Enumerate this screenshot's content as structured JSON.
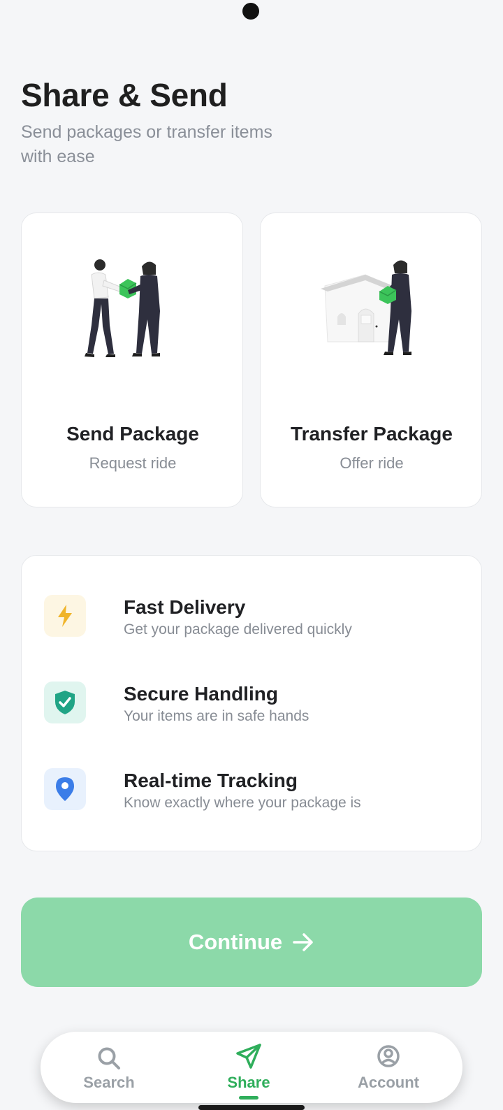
{
  "header": {
    "title": "Share & Send",
    "subtitle": "Send packages or transfer items with ease"
  },
  "cards": [
    {
      "title": "Send Package",
      "subtitle": "Request ride",
      "icon": "handover-illustration"
    },
    {
      "title": "Transfer Package",
      "subtitle": "Offer ride",
      "icon": "house-delivery-illustration"
    }
  ],
  "features": [
    {
      "title": "Fast Delivery",
      "description": "Get your package delivered quickly",
      "icon": "lightning-icon",
      "icon_color": "#f0b429",
      "icon_bg": "#fdf6e3"
    },
    {
      "title": "Secure Handling",
      "description": "Your items are in safe hands",
      "icon": "shield-check-icon",
      "icon_color": "#20a485",
      "icon_bg": "#e0f5ef"
    },
    {
      "title": "Real-time Tracking",
      "description": "Know exactly where your package is",
      "icon": "location-pin-icon",
      "icon_color": "#3b7de8",
      "icon_bg": "#e8f1fd"
    }
  ],
  "continue_button": {
    "label": "Continue",
    "color": "#8cd9a9"
  },
  "nav": {
    "items": [
      {
        "label": "Search",
        "icon": "search-icon",
        "active": false
      },
      {
        "label": "Share",
        "icon": "send-icon",
        "active": true
      },
      {
        "label": "Account",
        "icon": "account-icon",
        "active": false
      }
    ],
    "active_color": "#2fae5b",
    "inactive_color": "#9aa0a6"
  }
}
